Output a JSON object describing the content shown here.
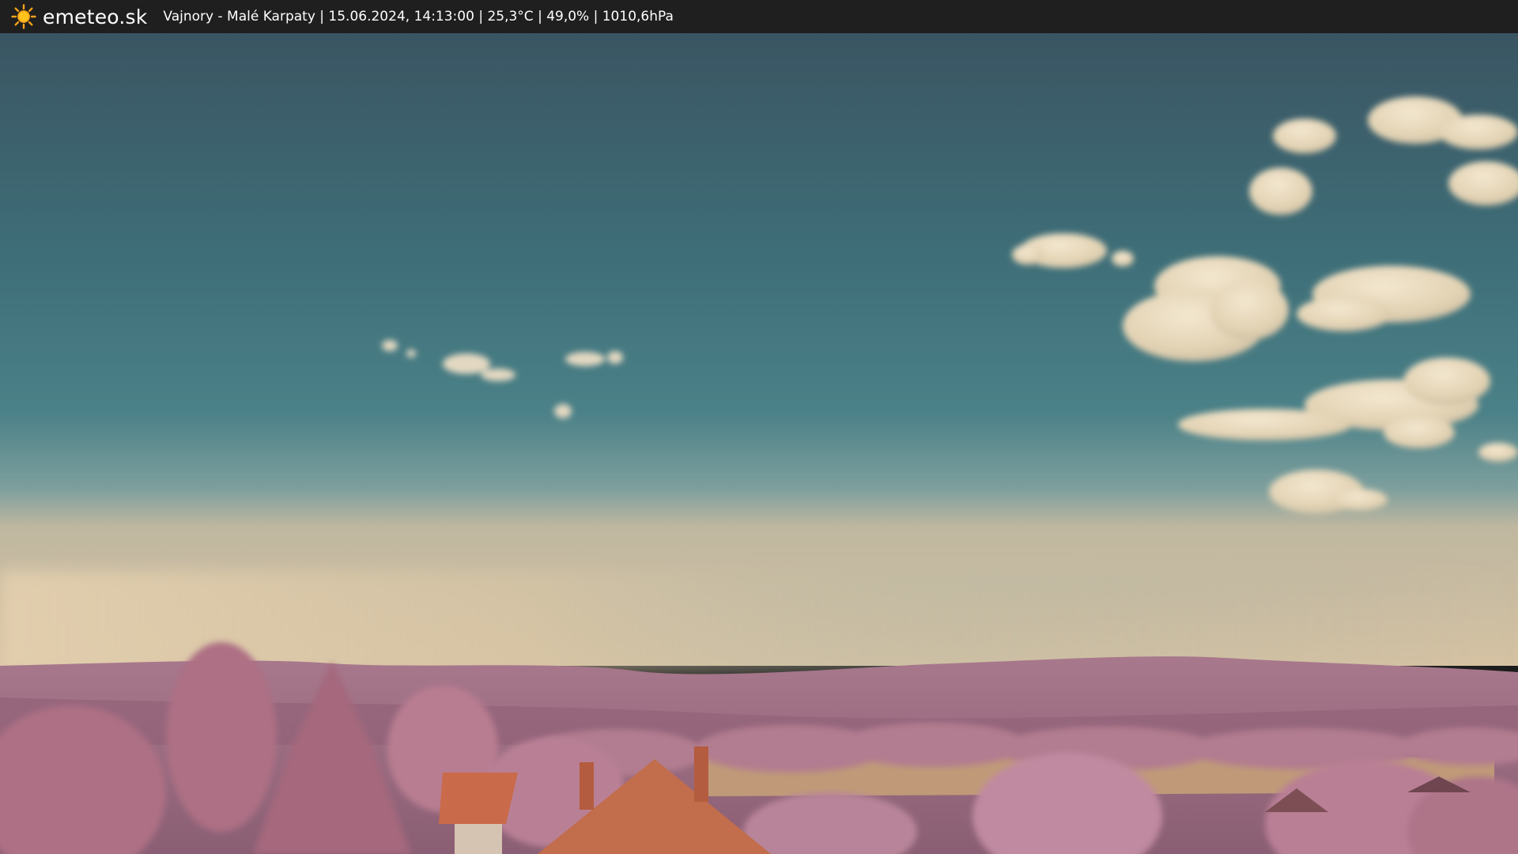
{
  "header": {
    "brand": "emeteo.sk",
    "station_line": "Vajnory - Malé Karpaty | 15.06.2024, 14:13:00 | 25,3°C | 49,0% | 1010,6hPa",
    "icon": "sun-icon"
  },
  "scene": {
    "description_icon": "webcam-image",
    "colors": {
      "sky_top": "#3b5560",
      "sky_mid": "#3f7a82",
      "sky_horizon": "#8aa7a2",
      "haze": "#d9c8a8",
      "hills": "#a06f86",
      "trees": "#b77a8e",
      "field": "#c39c76",
      "roof": "#c96a4a"
    }
  }
}
